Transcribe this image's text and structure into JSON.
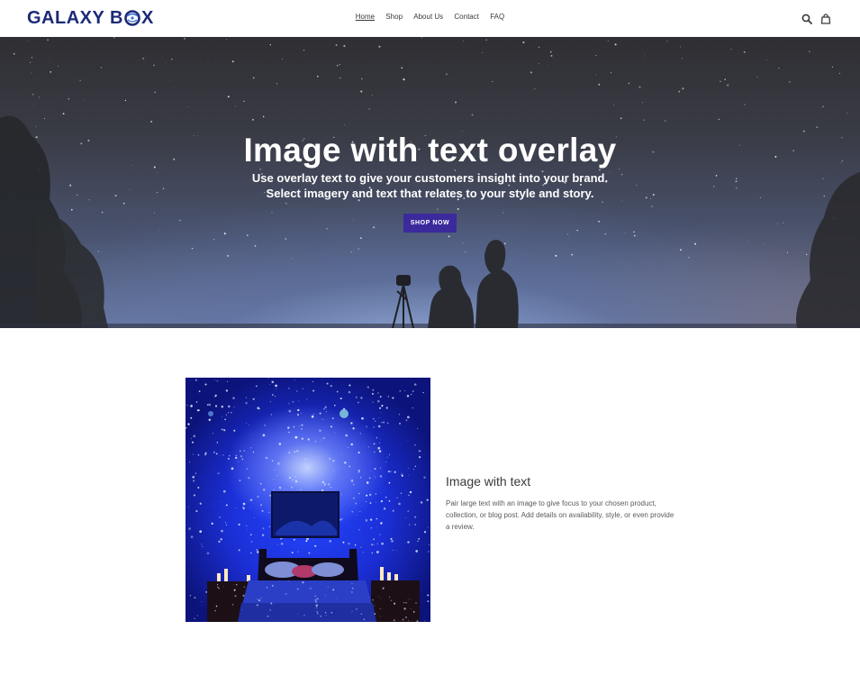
{
  "brand": {
    "logo_text_before": "GALAXY B",
    "logo_text_after": "X",
    "logo_color": "#1c2a78"
  },
  "nav": {
    "items": [
      {
        "label": "Home",
        "active": true
      },
      {
        "label": "Shop",
        "active": false
      },
      {
        "label": "About Us",
        "active": false
      },
      {
        "label": "Contact",
        "active": false
      },
      {
        "label": "FAQ",
        "active": false
      }
    ]
  },
  "header_icons": {
    "search": "search-icon",
    "cart": "cart-icon"
  },
  "hero": {
    "title": "Image with text overlay",
    "subtitle": "Use overlay text to give your customers insight into your brand. Select imagery and text that relates to your style and story.",
    "button_label": "SHOP NOW",
    "button_color": "#3b2a9c"
  },
  "feature": {
    "title": "Image with text",
    "body": "Pair large text with an image to give focus to your chosen product, collection, or blog post. Add details on availability, style, or even provide a review."
  }
}
